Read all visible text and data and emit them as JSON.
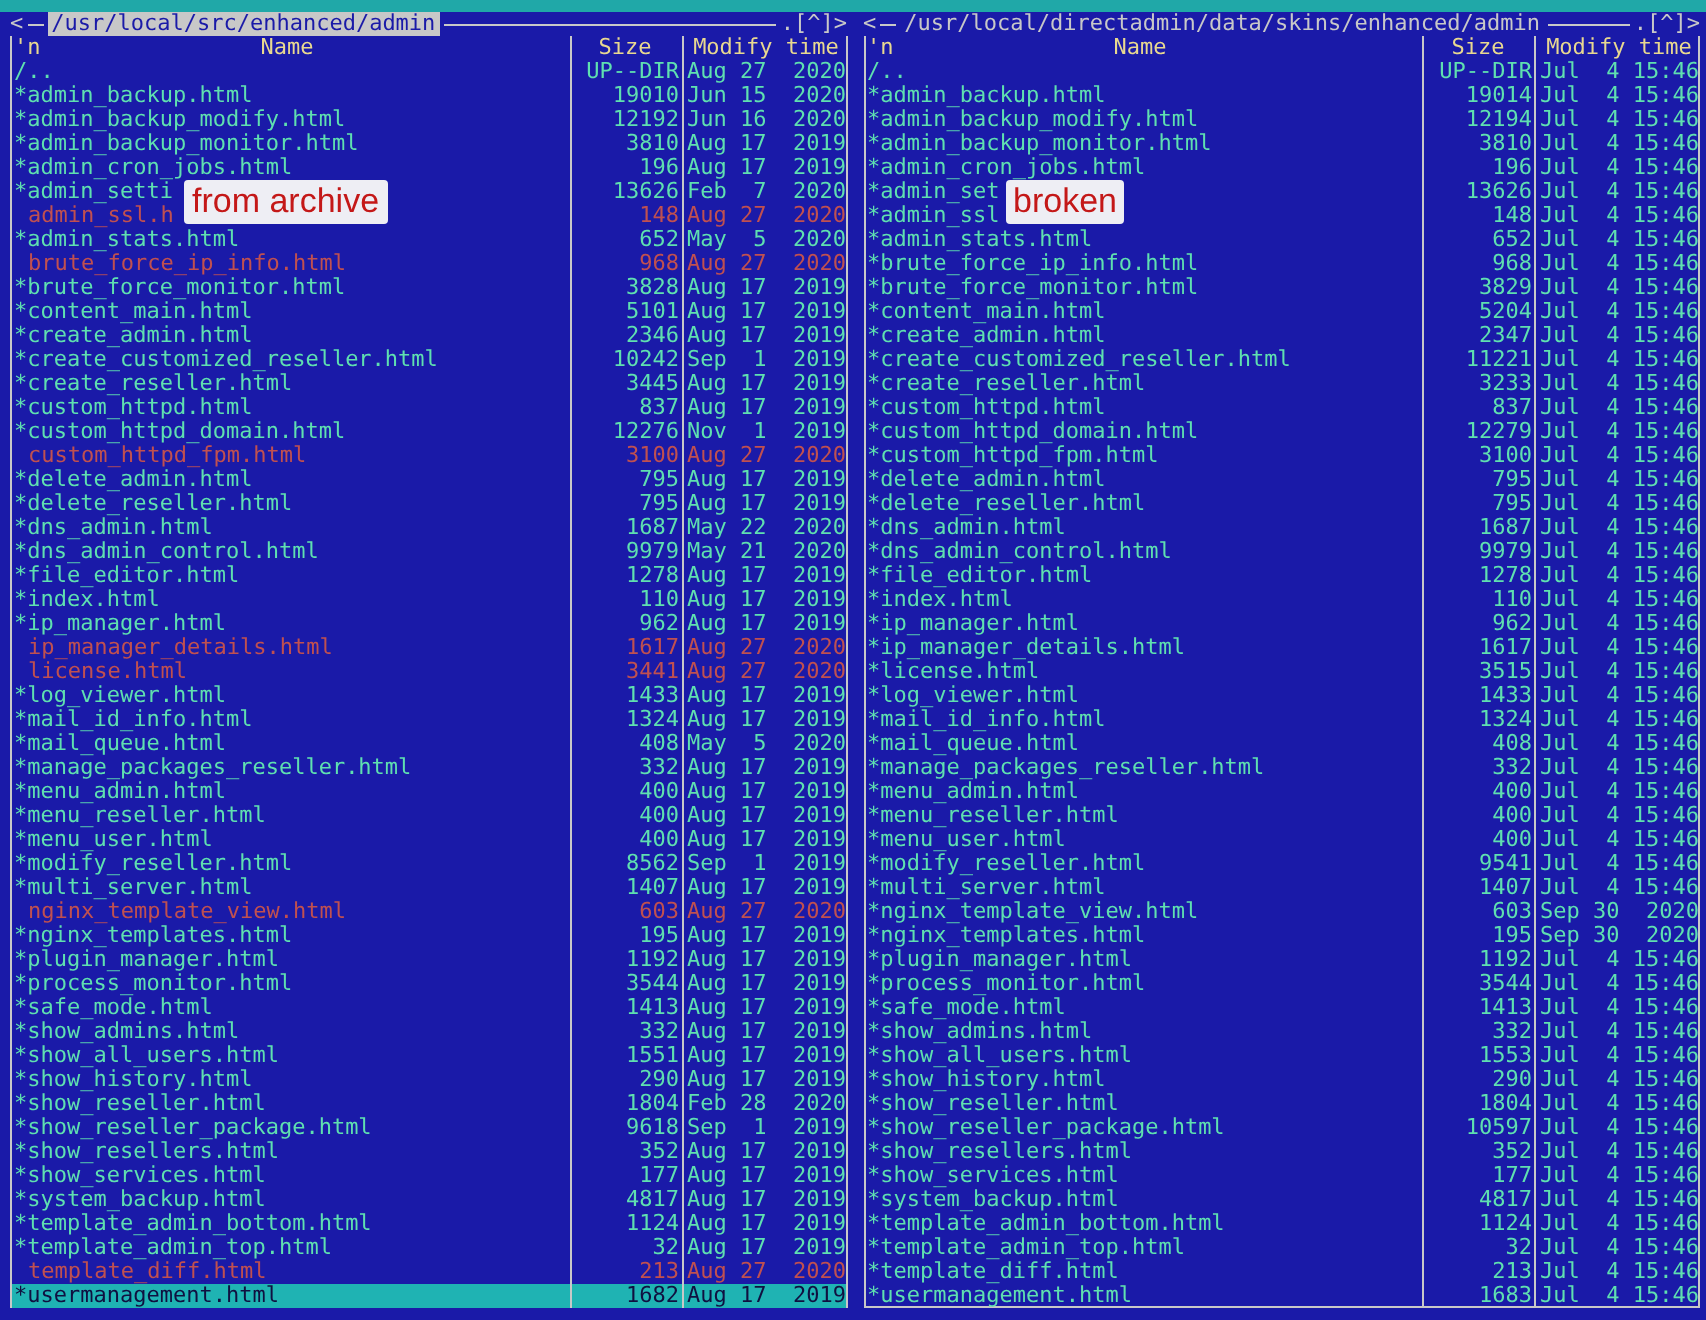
{
  "panels": [
    {
      "active": true,
      "nav": "<",
      "path": "/usr/local/src/enhanced/admin",
      "controls": ".[^]>",
      "columns": [
        "'n",
        "Name",
        "Size",
        "Modify time"
      ],
      "annotation": "from archive",
      "files": [
        {
          "name": "/..",
          "size": "UP--DIR",
          "modified": "Aug 27  2020",
          "kind": "dir",
          "selected": false
        },
        {
          "name": "*admin_backup.html",
          "size": "19010",
          "modified": "Jun 15  2020",
          "kind": "exec",
          "selected": false
        },
        {
          "name": "*admin_backup_modify.html",
          "size": "12192",
          "modified": "Jun 16  2020",
          "kind": "exec",
          "selected": false
        },
        {
          "name": "*admin_backup_monitor.html",
          "size": "3810",
          "modified": "Aug 17  2019",
          "kind": "exec",
          "selected": false
        },
        {
          "name": "*admin_cron_jobs.html",
          "size": "196",
          "modified": "Aug 17  2019",
          "kind": "exec",
          "selected": false
        },
        {
          "name": "*admin_setti",
          "size": "13626",
          "modified": "Feb  7  2020",
          "kind": "exec",
          "selected": false
        },
        {
          "name": "admin_ssl.h",
          "size": "148",
          "modified": "Aug 27  2020",
          "kind": "plain",
          "selected": false
        },
        {
          "name": "*admin_stats.html",
          "size": "652",
          "modified": "May  5  2020",
          "kind": "exec",
          "selected": false
        },
        {
          "name": "brute_force_ip_info.html",
          "size": "968",
          "modified": "Aug 27  2020",
          "kind": "plain",
          "selected": false
        },
        {
          "name": "*brute_force_monitor.html",
          "size": "3828",
          "modified": "Aug 17  2019",
          "kind": "exec",
          "selected": false
        },
        {
          "name": "*content_main.html",
          "size": "5101",
          "modified": "Aug 17  2019",
          "kind": "exec",
          "selected": false
        },
        {
          "name": "*create_admin.html",
          "size": "2346",
          "modified": "Aug 17  2019",
          "kind": "exec",
          "selected": false
        },
        {
          "name": "*create_customized_reseller.html",
          "size": "10242",
          "modified": "Sep  1  2019",
          "kind": "exec",
          "selected": false
        },
        {
          "name": "*create_reseller.html",
          "size": "3445",
          "modified": "Aug 17  2019",
          "kind": "exec",
          "selected": false
        },
        {
          "name": "*custom_httpd.html",
          "size": "837",
          "modified": "Aug 17  2019",
          "kind": "exec",
          "selected": false
        },
        {
          "name": "*custom_httpd_domain.html",
          "size": "12276",
          "modified": "Nov  1  2019",
          "kind": "exec",
          "selected": false
        },
        {
          "name": "custom_httpd_fpm.html",
          "size": "3100",
          "modified": "Aug 27  2020",
          "kind": "plain",
          "selected": false
        },
        {
          "name": "*delete_admin.html",
          "size": "795",
          "modified": "Aug 17  2019",
          "kind": "exec",
          "selected": false
        },
        {
          "name": "*delete_reseller.html",
          "size": "795",
          "modified": "Aug 17  2019",
          "kind": "exec",
          "selected": false
        },
        {
          "name": "*dns_admin.html",
          "size": "1687",
          "modified": "May 22  2020",
          "kind": "exec",
          "selected": false
        },
        {
          "name": "*dns_admin_control.html",
          "size": "9979",
          "modified": "May 21  2020",
          "kind": "exec",
          "selected": false
        },
        {
          "name": "*file_editor.html",
          "size": "1278",
          "modified": "Aug 17  2019",
          "kind": "exec",
          "selected": false
        },
        {
          "name": "*index.html",
          "size": "110",
          "modified": "Aug 17  2019",
          "kind": "exec",
          "selected": false
        },
        {
          "name": "*ip_manager.html",
          "size": "962",
          "modified": "Aug 17  2019",
          "kind": "exec",
          "selected": false
        },
        {
          "name": "ip_manager_details.html",
          "size": "1617",
          "modified": "Aug 27  2020",
          "kind": "plain",
          "selected": false
        },
        {
          "name": "license.html",
          "size": "3441",
          "modified": "Aug 27  2020",
          "kind": "plain",
          "selected": false
        },
        {
          "name": "*log_viewer.html",
          "size": "1433",
          "modified": "Aug 17  2019",
          "kind": "exec",
          "selected": false
        },
        {
          "name": "*mail_id_info.html",
          "size": "1324",
          "modified": "Aug 17  2019",
          "kind": "exec",
          "selected": false
        },
        {
          "name": "*mail_queue.html",
          "size": "408",
          "modified": "May  5  2020",
          "kind": "exec",
          "selected": false
        },
        {
          "name": "*manage_packages_reseller.html",
          "size": "332",
          "modified": "Aug 17  2019",
          "kind": "exec",
          "selected": false
        },
        {
          "name": "*menu_admin.html",
          "size": "400",
          "modified": "Aug 17  2019",
          "kind": "exec",
          "selected": false
        },
        {
          "name": "*menu_reseller.html",
          "size": "400",
          "modified": "Aug 17  2019",
          "kind": "exec",
          "selected": false
        },
        {
          "name": "*menu_user.html",
          "size": "400",
          "modified": "Aug 17  2019",
          "kind": "exec",
          "selected": false
        },
        {
          "name": "*modify_reseller.html",
          "size": "8562",
          "modified": "Sep  1  2019",
          "kind": "exec",
          "selected": false
        },
        {
          "name": "*multi_server.html",
          "size": "1407",
          "modified": "Aug 17  2019",
          "kind": "exec",
          "selected": false
        },
        {
          "name": "nginx_template_view.html",
          "size": "603",
          "modified": "Aug 27  2020",
          "kind": "plain",
          "selected": false
        },
        {
          "name": "*nginx_templates.html",
          "size": "195",
          "modified": "Aug 17  2019",
          "kind": "exec",
          "selected": false
        },
        {
          "name": "*plugin_manager.html",
          "size": "1192",
          "modified": "Aug 17  2019",
          "kind": "exec",
          "selected": false
        },
        {
          "name": "*process_monitor.html",
          "size": "3544",
          "modified": "Aug 17  2019",
          "kind": "exec",
          "selected": false
        },
        {
          "name": "*safe_mode.html",
          "size": "1413",
          "modified": "Aug 17  2019",
          "kind": "exec",
          "selected": false
        },
        {
          "name": "*show_admins.html",
          "size": "332",
          "modified": "Aug 17  2019",
          "kind": "exec",
          "selected": false
        },
        {
          "name": "*show_all_users.html",
          "size": "1551",
          "modified": "Aug 17  2019",
          "kind": "exec",
          "selected": false
        },
        {
          "name": "*show_history.html",
          "size": "290",
          "modified": "Aug 17  2019",
          "kind": "exec",
          "selected": false
        },
        {
          "name": "*show_reseller.html",
          "size": "1804",
          "modified": "Feb 28  2020",
          "kind": "exec",
          "selected": false
        },
        {
          "name": "*show_reseller_package.html",
          "size": "9618",
          "modified": "Sep  1  2019",
          "kind": "exec",
          "selected": false
        },
        {
          "name": "*show_resellers.html",
          "size": "352",
          "modified": "Aug 17  2019",
          "kind": "exec",
          "selected": false
        },
        {
          "name": "*show_services.html",
          "size": "177",
          "modified": "Aug 17  2019",
          "kind": "exec",
          "selected": false
        },
        {
          "name": "*system_backup.html",
          "size": "4817",
          "modified": "Aug 17  2019",
          "kind": "exec",
          "selected": false
        },
        {
          "name": "*template_admin_bottom.html",
          "size": "1124",
          "modified": "Aug 17  2019",
          "kind": "exec",
          "selected": false
        },
        {
          "name": "*template_admin_top.html",
          "size": "32",
          "modified": "Aug 17  2019",
          "kind": "exec",
          "selected": false
        },
        {
          "name": "template_diff.html",
          "size": "213",
          "modified": "Aug 27  2020",
          "kind": "plain",
          "selected": false
        },
        {
          "name": "*usermanagement.html",
          "size": "1682",
          "modified": "Aug 17  2019",
          "kind": "exec",
          "selected": true
        }
      ]
    },
    {
      "active": false,
      "nav": "<",
      "path": "/usr/local/directadmin/data/skins/enhanced/admin",
      "controls": ".[^]>",
      "columns": [
        "'n",
        "Name",
        "Size",
        "Modify time"
      ],
      "annotation": "broken",
      "files": [
        {
          "name": "/..",
          "size": "UP--DIR",
          "modified": "Jul  4 15:46",
          "kind": "dir",
          "selected": false
        },
        {
          "name": "*admin_backup.html",
          "size": "19014",
          "modified": "Jul  4 15:46",
          "kind": "exec",
          "selected": false
        },
        {
          "name": "*admin_backup_modify.html",
          "size": "12194",
          "modified": "Jul  4 15:46",
          "kind": "exec",
          "selected": false
        },
        {
          "name": "*admin_backup_monitor.html",
          "size": "3810",
          "modified": "Jul  4 15:46",
          "kind": "exec",
          "selected": false
        },
        {
          "name": "*admin_cron_jobs.html",
          "size": "196",
          "modified": "Jul  4 15:46",
          "kind": "exec",
          "selected": false
        },
        {
          "name": "*admin_set",
          "size": "13626",
          "modified": "Jul  4 15:46",
          "kind": "exec",
          "selected": false
        },
        {
          "name": "*admin_ssl",
          "size": "148",
          "modified": "Jul  4 15:46",
          "kind": "exec",
          "selected": false
        },
        {
          "name": "*admin_stats.html",
          "size": "652",
          "modified": "Jul  4 15:46",
          "kind": "exec",
          "selected": false
        },
        {
          "name": "*brute_force_ip_info.html",
          "size": "968",
          "modified": "Jul  4 15:46",
          "kind": "exec",
          "selected": false
        },
        {
          "name": "*brute_force_monitor.html",
          "size": "3829",
          "modified": "Jul  4 15:46",
          "kind": "exec",
          "selected": false
        },
        {
          "name": "*content_main.html",
          "size": "5204",
          "modified": "Jul  4 15:46",
          "kind": "exec",
          "selected": false
        },
        {
          "name": "*create_admin.html",
          "size": "2347",
          "modified": "Jul  4 15:46",
          "kind": "exec",
          "selected": false
        },
        {
          "name": "*create_customized_reseller.html",
          "size": "11221",
          "modified": "Jul  4 15:46",
          "kind": "exec",
          "selected": false
        },
        {
          "name": "*create_reseller.html",
          "size": "3233",
          "modified": "Jul  4 15:46",
          "kind": "exec",
          "selected": false
        },
        {
          "name": "*custom_httpd.html",
          "size": "837",
          "modified": "Jul  4 15:46",
          "kind": "exec",
          "selected": false
        },
        {
          "name": "*custom_httpd_domain.html",
          "size": "12279",
          "modified": "Jul  4 15:46",
          "kind": "exec",
          "selected": false
        },
        {
          "name": "*custom_httpd_fpm.html",
          "size": "3100",
          "modified": "Jul  4 15:46",
          "kind": "exec",
          "selected": false
        },
        {
          "name": "*delete_admin.html",
          "size": "795",
          "modified": "Jul  4 15:46",
          "kind": "exec",
          "selected": false
        },
        {
          "name": "*delete_reseller.html",
          "size": "795",
          "modified": "Jul  4 15:46",
          "kind": "exec",
          "selected": false
        },
        {
          "name": "*dns_admin.html",
          "size": "1687",
          "modified": "Jul  4 15:46",
          "kind": "exec",
          "selected": false
        },
        {
          "name": "*dns_admin_control.html",
          "size": "9979",
          "modified": "Jul  4 15:46",
          "kind": "exec",
          "selected": false
        },
        {
          "name": "*file_editor.html",
          "size": "1278",
          "modified": "Jul  4 15:46",
          "kind": "exec",
          "selected": false
        },
        {
          "name": "*index.html",
          "size": "110",
          "modified": "Jul  4 15:46",
          "kind": "exec",
          "selected": false
        },
        {
          "name": "*ip_manager.html",
          "size": "962",
          "modified": "Jul  4 15:46",
          "kind": "exec",
          "selected": false
        },
        {
          "name": "*ip_manager_details.html",
          "size": "1617",
          "modified": "Jul  4 15:46",
          "kind": "exec",
          "selected": false
        },
        {
          "name": "*license.html",
          "size": "3515",
          "modified": "Jul  4 15:46",
          "kind": "exec",
          "selected": false
        },
        {
          "name": "*log_viewer.html",
          "size": "1433",
          "modified": "Jul  4 15:46",
          "kind": "exec",
          "selected": false
        },
        {
          "name": "*mail_id_info.html",
          "size": "1324",
          "modified": "Jul  4 15:46",
          "kind": "exec",
          "selected": false
        },
        {
          "name": "*mail_queue.html",
          "size": "408",
          "modified": "Jul  4 15:46",
          "kind": "exec",
          "selected": false
        },
        {
          "name": "*manage_packages_reseller.html",
          "size": "332",
          "modified": "Jul  4 15:46",
          "kind": "exec",
          "selected": false
        },
        {
          "name": "*menu_admin.html",
          "size": "400",
          "modified": "Jul  4 15:46",
          "kind": "exec",
          "selected": false
        },
        {
          "name": "*menu_reseller.html",
          "size": "400",
          "modified": "Jul  4 15:46",
          "kind": "exec",
          "selected": false
        },
        {
          "name": "*menu_user.html",
          "size": "400",
          "modified": "Jul  4 15:46",
          "kind": "exec",
          "selected": false
        },
        {
          "name": "*modify_reseller.html",
          "size": "9541",
          "modified": "Jul  4 15:46",
          "kind": "exec",
          "selected": false
        },
        {
          "name": "*multi_server.html",
          "size": "1407",
          "modified": "Jul  4 15:46",
          "kind": "exec",
          "selected": false
        },
        {
          "name": "*nginx_template_view.html",
          "size": "603",
          "modified": "Sep 30  2020",
          "kind": "exec",
          "selected": false
        },
        {
          "name": "*nginx_templates.html",
          "size": "195",
          "modified": "Sep 30  2020",
          "kind": "exec",
          "selected": false
        },
        {
          "name": "*plugin_manager.html",
          "size": "1192",
          "modified": "Jul  4 15:46",
          "kind": "exec",
          "selected": false
        },
        {
          "name": "*process_monitor.html",
          "size": "3544",
          "modified": "Jul  4 15:46",
          "kind": "exec",
          "selected": false
        },
        {
          "name": "*safe_mode.html",
          "size": "1413",
          "modified": "Jul  4 15:46",
          "kind": "exec",
          "selected": false
        },
        {
          "name": "*show_admins.html",
          "size": "332",
          "modified": "Jul  4 15:46",
          "kind": "exec",
          "selected": false
        },
        {
          "name": "*show_all_users.html",
          "size": "1553",
          "modified": "Jul  4 15:46",
          "kind": "exec",
          "selected": false
        },
        {
          "name": "*show_history.html",
          "size": "290",
          "modified": "Jul  4 15:46",
          "kind": "exec",
          "selected": false
        },
        {
          "name": "*show_reseller.html",
          "size": "1804",
          "modified": "Jul  4 15:46",
          "kind": "exec",
          "selected": false
        },
        {
          "name": "*show_reseller_package.html",
          "size": "10597",
          "modified": "Jul  4 15:46",
          "kind": "exec",
          "selected": false
        },
        {
          "name": "*show_resellers.html",
          "size": "352",
          "modified": "Jul  4 15:46",
          "kind": "exec",
          "selected": false
        },
        {
          "name": "*show_services.html",
          "size": "177",
          "modified": "Jul  4 15:46",
          "kind": "exec",
          "selected": false
        },
        {
          "name": "*system_backup.html",
          "size": "4817",
          "modified": "Jul  4 15:46",
          "kind": "exec",
          "selected": false
        },
        {
          "name": "*template_admin_bottom.html",
          "size": "1124",
          "modified": "Jul  4 15:46",
          "kind": "exec",
          "selected": false
        },
        {
          "name": "*template_admin_top.html",
          "size": "32",
          "modified": "Jul  4 15:46",
          "kind": "exec",
          "selected": false
        },
        {
          "name": "*template_diff.html",
          "size": "213",
          "modified": "Jul  4 15:46",
          "kind": "exec",
          "selected": false
        },
        {
          "name": "*usermanagement.html",
          "size": "1683",
          "modified": "Jul  4 15:46",
          "kind": "exec",
          "selected": false
        }
      ]
    }
  ]
}
